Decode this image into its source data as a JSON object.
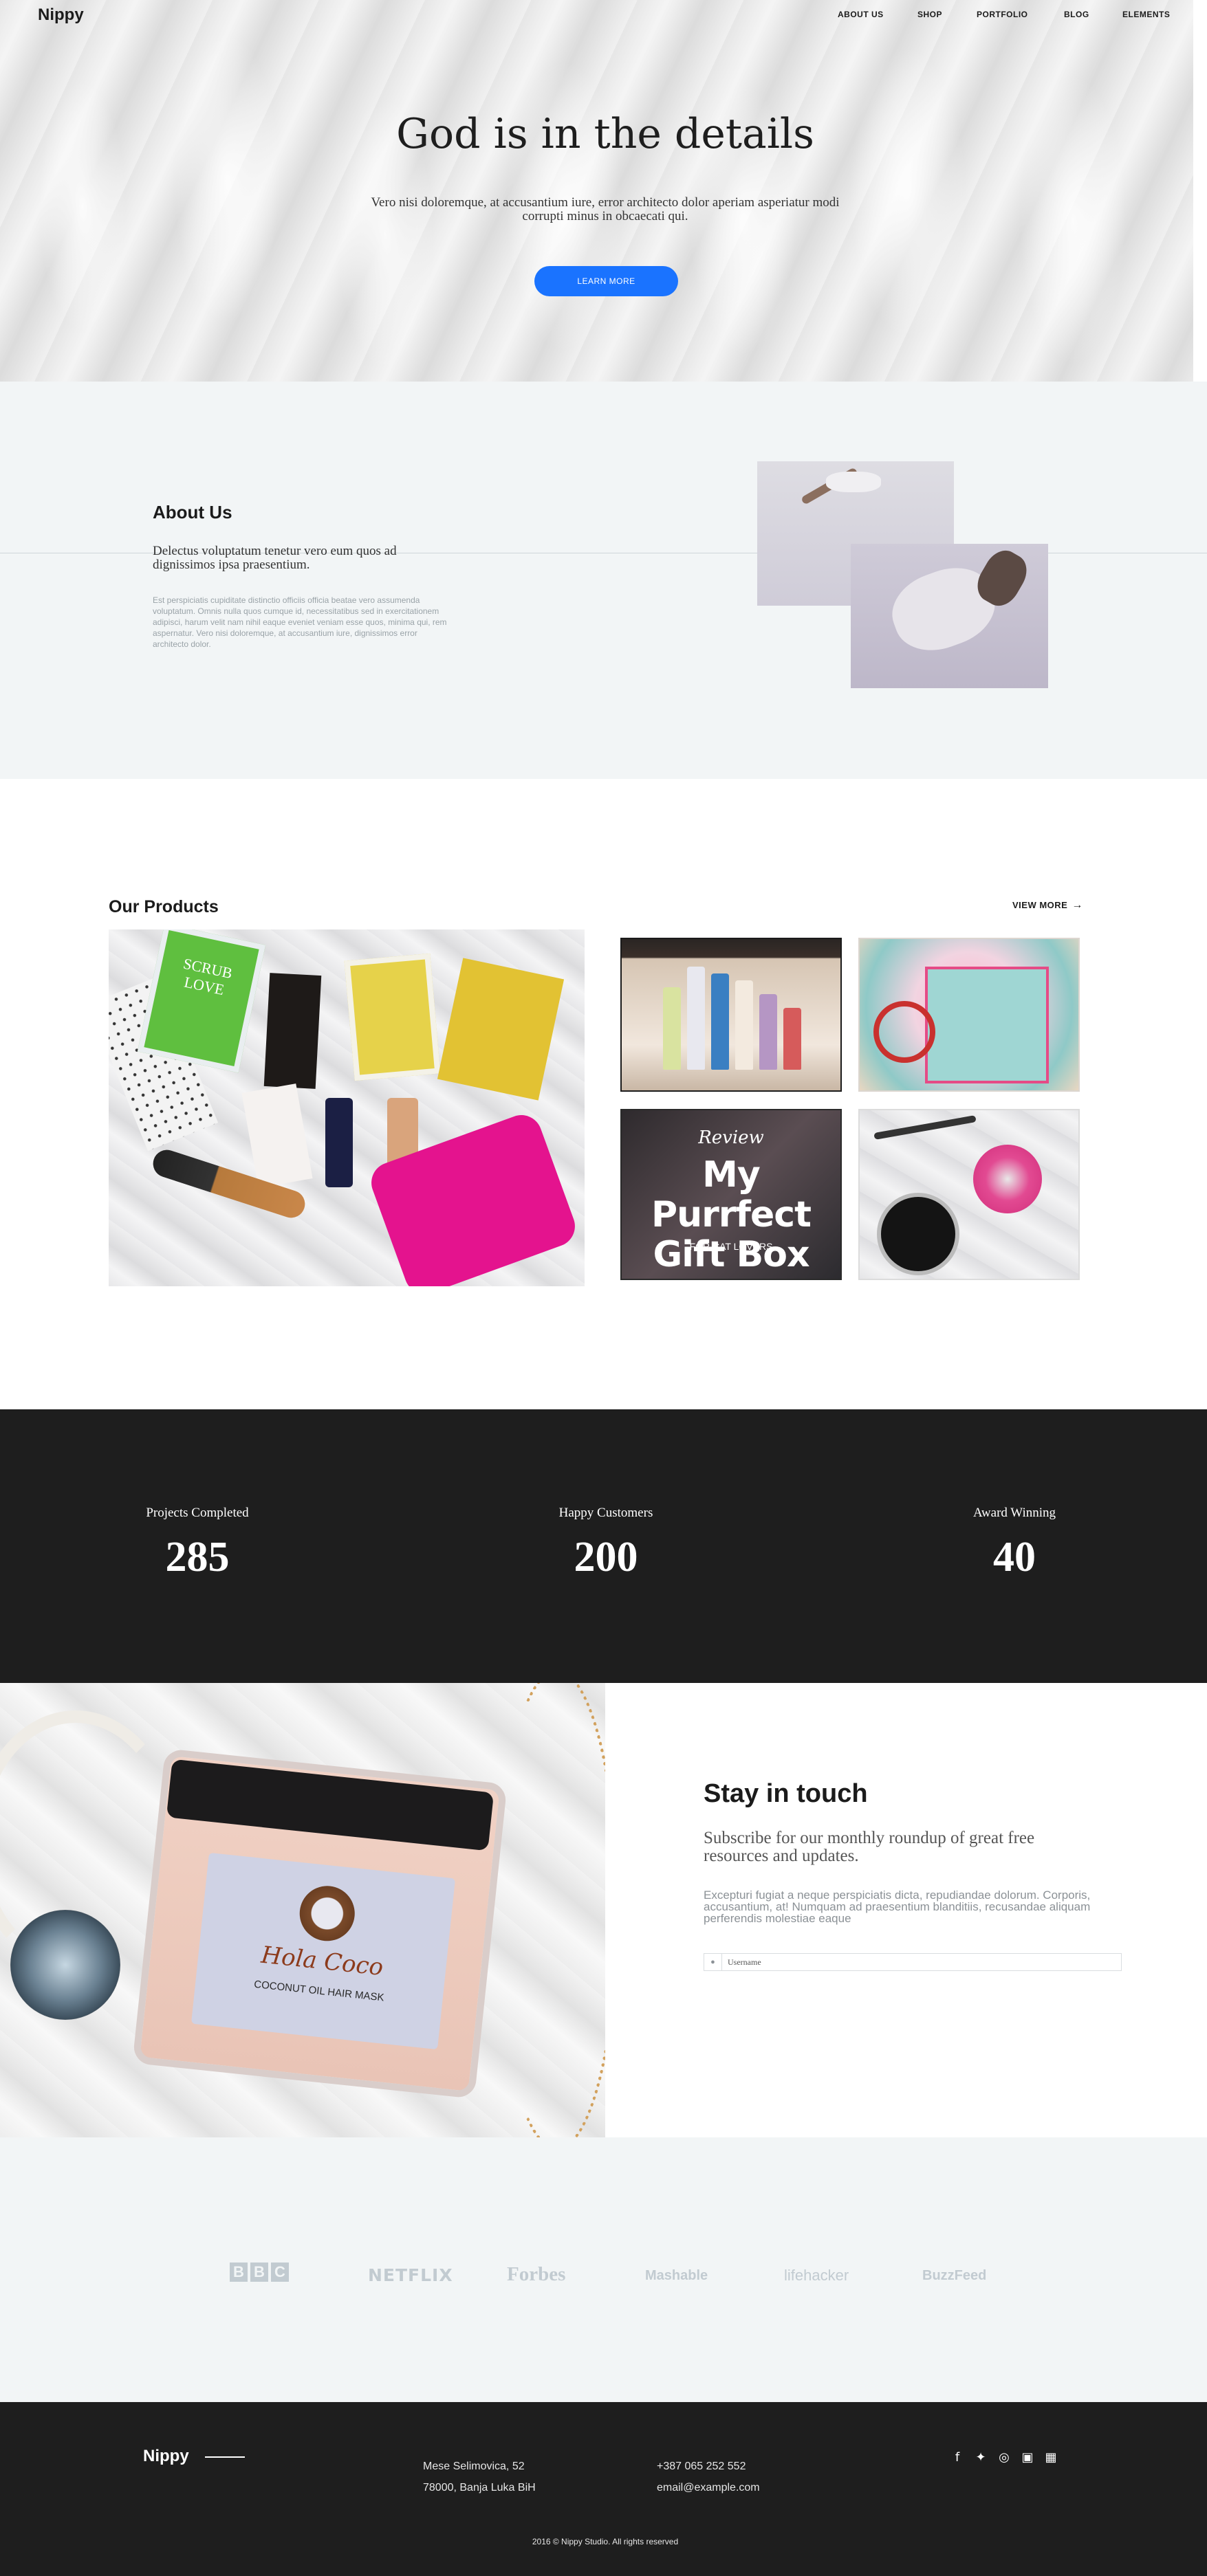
{
  "header": {
    "logo": "Nippy",
    "nav": [
      "ABOUT US",
      "SHOP",
      "PORTFOLIO",
      "BLOG",
      "ELEMENTS"
    ]
  },
  "hero": {
    "title": "God is in the details",
    "subtitle": "Vero nisi doloremque, at accusantium iure, error architecto dolor aperiam asperiatur modi corrupti minus in obcaecati qui.",
    "button": "LEARN MORE",
    "button_color": "#1a73ff"
  },
  "about": {
    "title": "About Us",
    "lead": "Delectus voluptatum tenetur vero eum quos ad dignissimos ipsa praesentium.",
    "body": "Est perspiciatis cupiditate distinctio officiis officia beatae vero assumenda voluptatum. Omnis nulla quos cumque id, necessitatibus sed in exercitationem adipisci, harum velit nam nihil eaque eveniet veniam esse quos, minima qui, rem aspernatur. Vero nisi doloremque, at accusantium iure, dignissimos error architecto dolor."
  },
  "products": {
    "title": "Our Products",
    "view_more": "VIEW  MORE",
    "arrow_icon": "arrow-right-icon",
    "big_tile": {
      "label1": "SCRUB LOVE"
    },
    "tile3": {
      "line1": "Review",
      "line2": "My Purrfect",
      "line3": "Gift Box",
      "line4": "FOR CAT LOVERS"
    },
    "jar": {
      "brand": "Hola Coco",
      "line": "COCONUT OIL HAIR MASK"
    }
  },
  "stats": [
    {
      "label": "Projects Completed",
      "value": "285"
    },
    {
      "label": "Happy Customers",
      "value": "200"
    },
    {
      "label": "Award Winning",
      "value": "40"
    }
  ],
  "subscribe": {
    "title": "Stay in touch",
    "lead": "Subscribe for our monthly roundup of great free resources and updates.",
    "body": "Excepturi fugiat a neque perspiciatis dicta, repudiandae dolorum. Corporis, accusantium, at! Numquam ad praesentium blanditiis, recusandae aliquam perferendis molestiae eaque",
    "input_value": "Username",
    "input_icon": "user-icon"
  },
  "brands": [
    "BBC",
    "NETFLIX",
    "Forbes",
    "Mashable",
    "lifehacker",
    "BuzzFeed"
  ],
  "footer": {
    "logo": "Nippy",
    "address_line1": "Mese Selimovica, 52",
    "address_line2": "78000, Banja Luka BiH",
    "phone": "+387 065 252 552",
    "email": "email@example.com",
    "social_icons": [
      "facebook-icon",
      "twitter-icon",
      "dribbble-icon",
      "instagram-icon",
      "linkedin-icon"
    ],
    "copyright": "2016 © Nippy Studio. All rights reserved"
  }
}
